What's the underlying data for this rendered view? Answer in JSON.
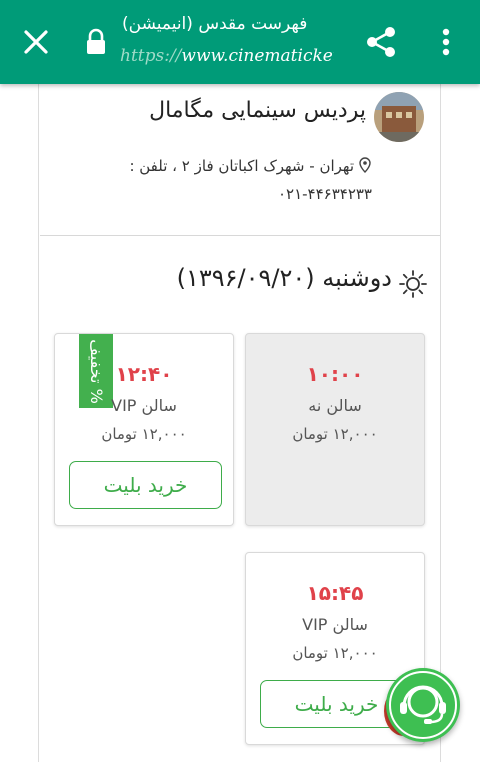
{
  "browser": {
    "title": "فهرست مقدس (انیمیشن)",
    "url_scheme": "https://",
    "url_host": "www.cinematicket.",
    "icons": {
      "close": "close-icon",
      "lock": "lock-icon",
      "share": "share-icon",
      "menu": "more-vert-icon"
    }
  },
  "cinema": {
    "name": "پردیس سینمایی مگامال",
    "address": "تهران - شهرک اکباتان فاز ۲ ، تلفن :",
    "phone": "۰۲۱-۴۴۶۳۴۲۳۳",
    "icons": {
      "logo": "cinema-logo",
      "location": "location-pin-icon"
    }
  },
  "day": {
    "title": "دوشنبه (۱۳۹۶/۰۹/۲۰)",
    "icon": "sun-icon"
  },
  "showtimes": [
    {
      "time": "۱۰:۰۰",
      "hall": "سالن نه",
      "price": "۱۲,۰۰۰ تومان",
      "status": "past"
    },
    {
      "time": "۱۲:۴۰",
      "hall": "سالن VIP",
      "price": "۱۲,۰۰۰ تومان",
      "discount": "% تخفیف",
      "button": "خرید بلیت"
    },
    {
      "time": "۱۵:۴۵",
      "hall": "سالن VIP",
      "price": "۱۲,۰۰۰ تومان",
      "button": "خرید بلیت"
    }
  ],
  "support": {
    "icon": "support-headset-icon"
  },
  "colors": {
    "topbar": "#009b78",
    "accent_green": "#3eac4a",
    "time_red": "#e0424a",
    "fab_green": "#3ebf52"
  }
}
